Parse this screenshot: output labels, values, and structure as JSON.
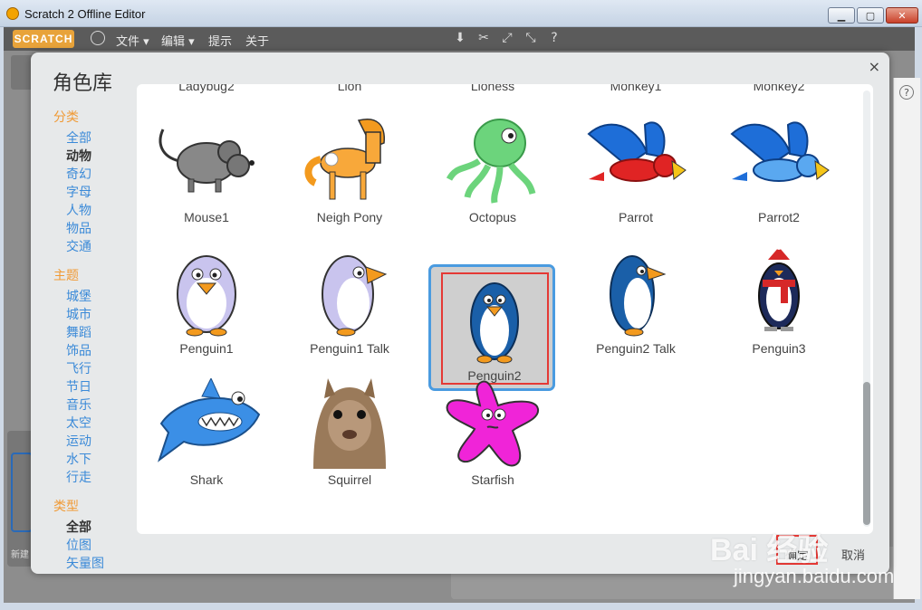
{
  "window": {
    "title": "Scratch 2 Offline Editor",
    "min": "▁",
    "max": "▢",
    "close": "✕"
  },
  "menubar": {
    "logo": "SCRATCH",
    "items": [
      "文件 ▾",
      "编辑 ▾",
      "提示",
      "关于"
    ],
    "tools": [
      "copy-tool-icon",
      "cut-tool-icon",
      "grow-icon",
      "shrink-icon",
      "help-icon"
    ]
  },
  "dialog": {
    "title": "角色库",
    "close": "×",
    "sidebar": {
      "category_heading": "分类",
      "categories": [
        "全部",
        "动物",
        "奇幻",
        "字母",
        "人物",
        "物品",
        "交通"
      ],
      "active_category": "动物",
      "theme_heading": "主题",
      "themes": [
        "城堡",
        "城市",
        "舞蹈",
        "饰品",
        "飞行",
        "节日",
        "音乐",
        "太空",
        "运动",
        "水下",
        "行走"
      ],
      "type_heading": "类型",
      "types": [
        "全部",
        "位图",
        "矢量图"
      ],
      "active_type": "全部"
    },
    "sprites_row0": [
      "Ladybug2",
      "Lion",
      "Lioness",
      "Monkey1",
      "Monkey2"
    ],
    "sprites": [
      [
        "Mouse1",
        "Neigh Pony",
        "Octopus",
        "Parrot",
        "Parrot2"
      ],
      [
        "Penguin1",
        "Penguin1 Talk",
        "Penguin2",
        "Penguin2 Talk",
        "Penguin3"
      ],
      [
        "Shark",
        "Squirrel",
        "Starfish"
      ]
    ],
    "selected": "Penguin2",
    "ok": "确定",
    "cancel": "取消"
  },
  "watermark": {
    "main": "Bai 经验",
    "sub": "jingyan.baidu.com"
  },
  "left_panel": {
    "new_label": "新建"
  }
}
